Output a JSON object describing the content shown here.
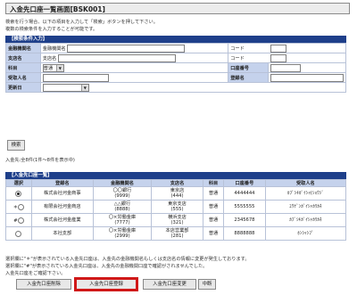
{
  "page": {
    "title": "入金先口座一覧画面[BSK001]"
  },
  "instructions": [
    "検索を行う場合、以下の項目を入力して「検索」ボタンを押して下さい。",
    "複数の検索条件を入力することが可能です。"
  ],
  "search": {
    "header": "【検索条件入力】",
    "bank_label": "金融機関名",
    "bank_sub": "金融機関名",
    "bank_code_label": "コード",
    "branch_label": "支店名",
    "branch_sub": "支店名",
    "branch_code_label": "コード",
    "type_label": "科目",
    "type_value": "普通",
    "account_label": "口座番号",
    "holder_label": "受取人名",
    "reg_label": "登録名",
    "updated_label": "更新日"
  },
  "buttons": {
    "search": "検索",
    "delete": "入金先口座削除",
    "register": "入金先口座登録",
    "change": "入金先口座変更",
    "cancel": "中断"
  },
  "result_count": "入金先:全8件(1件〜8件を表示中)",
  "list": {
    "header": "【入金先口座一覧】",
    "columns": [
      "選択",
      "登録名",
      "金融機関名",
      "支店名",
      "科目",
      "口座番号",
      "受取人名"
    ],
    "rows": [
      {
        "sel": "●",
        "radio": true,
        "name": "株式会社河金商事",
        "bank": "〇〇銀行",
        "bank_code": "(9999)",
        "branch": "東京店",
        "branch_code": "(444)",
        "type": "普通",
        "account": "4444444",
        "holder": "ｶﾌﾞｼｷｶﾞｲｼｬ(ｼｮｳｼﾞ"
      },
      {
        "sel": "＊○",
        "radio": false,
        "name": "有限会社河金商店",
        "bank": "△△銀行",
        "bank_code": "(8888)",
        "branch": "東京支店",
        "branch_code": "(555)",
        "type": "普通",
        "account": "5555555",
        "holder": "ﾕｳｹﾞﾝｶﾞｲｼｬｶﾜｶﾈ"
      },
      {
        "sel": "#○",
        "radio": false,
        "name": "株式会社河金産業",
        "bank": "〇×労働金庫",
        "bank_code": "(7777)",
        "branch": "横浜支店",
        "branch_code": "(321)",
        "type": "普通",
        "account": "2345678",
        "holder": "ｶﾌﾞｼｷｶﾞｲｼｬｶﾜｶﾈ"
      },
      {
        "sel": "○",
        "radio": false,
        "name": "本社支部",
        "bank": "〇×労働金庫",
        "bank_code": "(2999)",
        "branch": "本店営業部",
        "branch_code": "(281)",
        "type": "普通",
        "account": "8888888",
        "holder": "ﾎﾝｼｬｼﾌﾞ"
      }
    ]
  },
  "notes": [
    "選択欄に\"＊\"が表示されている入金先口座は、入金先の金融機関名もしくは支店名の情報に変更が発生しております。",
    "選択欄に\"#\"が表示されている入金先口座は、入金先の金融機関口座で確認がされませんでした。",
    "入金先口座をご確認下さい。"
  ]
}
